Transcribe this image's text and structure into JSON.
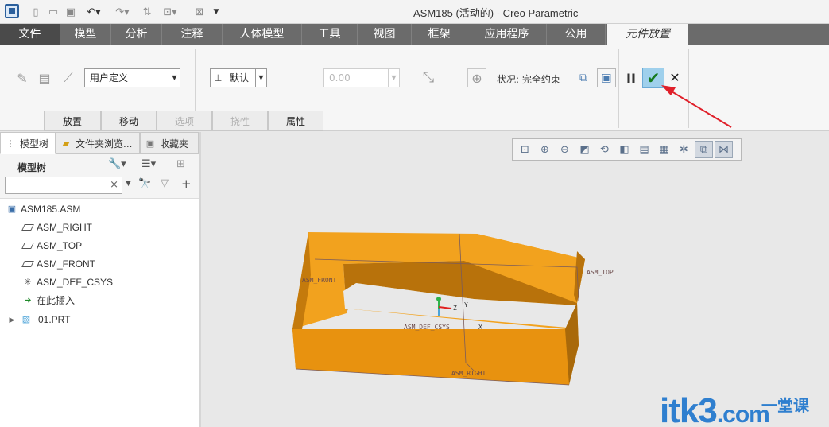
{
  "window": {
    "title": "ASM185 (活动的) - Creo Parametric"
  },
  "quick_access": [
    "new-icon",
    "open-icon",
    "save-icon",
    "undo-icon",
    "redo-icon",
    "regenerate-icon",
    "windows-icon",
    "close-window-icon",
    "customize-icon"
  ],
  "ribbon_tabs": [
    {
      "label": "文件"
    },
    {
      "label": "模型"
    },
    {
      "label": "分析"
    },
    {
      "label": "注释"
    },
    {
      "label": "人体模型"
    },
    {
      "label": "工具"
    },
    {
      "label": "视图"
    },
    {
      "label": "框架"
    },
    {
      "label": "应用程序"
    },
    {
      "label": "公用"
    },
    {
      "label": "元件放置"
    }
  ],
  "placement": {
    "constraint_type": "用户定义",
    "constraint": "默认",
    "offset_value": "0.00",
    "status": "状况: 完全约束"
  },
  "sub_tabs": [
    {
      "label": "放置",
      "enabled": true
    },
    {
      "label": "移动",
      "enabled": true
    },
    {
      "label": "选项",
      "enabled": false
    },
    {
      "label": "挠性",
      "enabled": false
    },
    {
      "label": "属性",
      "enabled": true
    }
  ],
  "panel_tabs": [
    {
      "label": "模型树",
      "icon": "model-tree-icon"
    },
    {
      "label": "文件夹浏览...",
      "icon": "folder-browser-icon"
    },
    {
      "label": "收藏夹",
      "icon": "favorites-icon"
    }
  ],
  "model_tree": {
    "title": "模型树",
    "search_value": "",
    "items": [
      {
        "label": "ASM185.ASM",
        "icon": "assembly-icon"
      },
      {
        "label": "ASM_RIGHT",
        "icon": "datum-plane-icon"
      },
      {
        "label": "ASM_TOP",
        "icon": "datum-plane-icon"
      },
      {
        "label": "ASM_FRONT",
        "icon": "datum-plane-icon"
      },
      {
        "label": "ASM_DEF_CSYS",
        "icon": "csys-icon"
      },
      {
        "label": "在此插入",
        "icon": "insert-here-icon"
      },
      {
        "label": "01.PRT",
        "icon": "part-icon"
      }
    ]
  },
  "graphics_labels": {
    "asm_front": "ASM_FRONT",
    "asm_top": "ASM_TOP",
    "asm_def_csys": "ASM_DEF_CSYS",
    "asm_right": "ASM_RIGHT",
    "axis_x": "X",
    "axis_y": "Y",
    "axis_z": "Z"
  },
  "colors": {
    "part": "#f2a21e",
    "part_dark": "#b8720b",
    "accent": "#2f7fcf",
    "arrow": "#e0202a"
  },
  "watermark": {
    "text": "itk3",
    "domain": ".com",
    "cn": "一堂课"
  }
}
